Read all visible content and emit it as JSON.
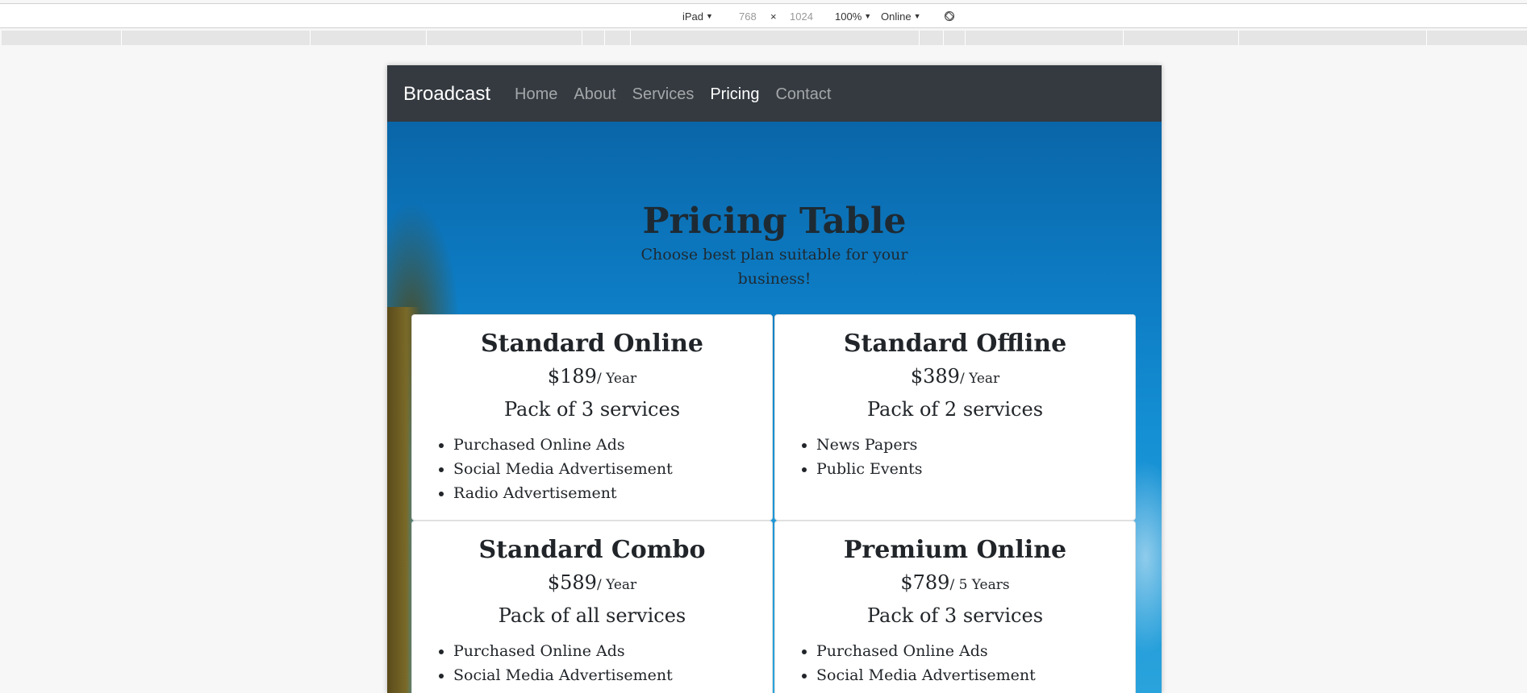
{
  "device_toolbar": {
    "device": "iPad",
    "width": "768",
    "times": "×",
    "height": "1024",
    "zoom": "100%",
    "network": "Online",
    "rotate_icon": "rotate-icon"
  },
  "navbar": {
    "brand": "Broadcast",
    "links": [
      {
        "label": "Home",
        "active": false
      },
      {
        "label": "About",
        "active": false
      },
      {
        "label": "Services",
        "active": false
      },
      {
        "label": "Pricing",
        "active": true
      },
      {
        "label": "Contact",
        "active": false
      }
    ]
  },
  "hero": {
    "title": "Pricing Table",
    "subtitle": "Choose best plan suitable for your business!"
  },
  "plans": [
    {
      "name": "Standard Online",
      "price": "$189",
      "period": "/ Year",
      "pack": "Pack of 3 services",
      "features": [
        "Purchased Online Ads",
        "Social Media Advertisement",
        "Radio Advertisement"
      ]
    },
    {
      "name": "Standard Offline",
      "price": "$389",
      "period": "/ Year",
      "pack": "Pack of 2 services",
      "features": [
        "News Papers",
        "Public Events"
      ]
    },
    {
      "name": "Standard Combo",
      "price": "$589",
      "period": "/ Year",
      "pack": "Pack of all services",
      "features": [
        "Purchased Online Ads",
        "Social Media Advertisement"
      ]
    },
    {
      "name": "Premium Online",
      "price": "$789",
      "period": "/ 5 Years",
      "pack": "Pack of 3 services",
      "features": [
        "Purchased Online Ads",
        "Social Media Advertisement"
      ]
    }
  ],
  "colors": {
    "navbar_bg": "#343a40",
    "hero_sky": "#0d7cc4",
    "card_bg": "#ffffff",
    "text": "#212529"
  }
}
